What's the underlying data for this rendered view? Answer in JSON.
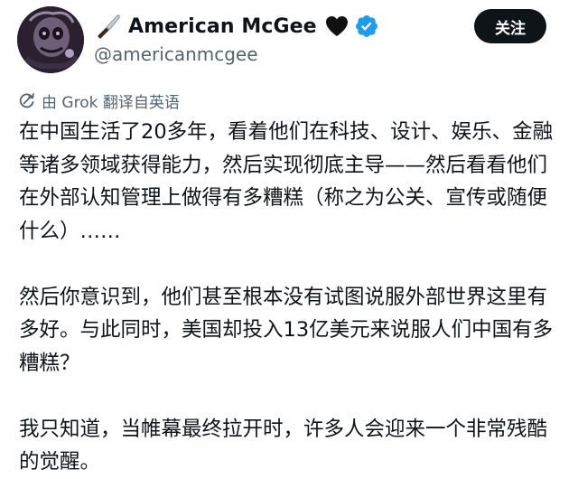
{
  "author": {
    "display_name": "American McGee",
    "handle": "@americanmcgee",
    "knife_emoji_icon": "kitchen-knife-icon",
    "heart_emoji_icon": "black-heart-icon",
    "verified_icon": "verified-badge-icon",
    "verified_color": "#1d9bf0"
  },
  "follow_button": {
    "label": "关注",
    "background": "#0f1419",
    "text_color": "#ffffff"
  },
  "translation": {
    "label": "由 Grok 翻译自英语",
    "icon": "translate-icon"
  },
  "tweet": {
    "paragraphs": [
      "在中国生活了20多年，看着他们在科技、设计、娱乐、金融等诸多领域获得能力，然后实现彻底主导——然后看看他们在外部认知管理上做得有多糟糕（称之为公关、宣传或随便什么）……",
      "然后你意识到，他们甚至根本没有试图说服外部世界这里有多好。与此同时，美国却投入13亿美元来说服人们中国有多糟糕？",
      "我只知道，当帷幕最终拉开时，许多人会迎来一个非常残酷的觉醒。"
    ]
  },
  "colors": {
    "text_primary": "#0f1419",
    "text_secondary": "#536471",
    "background": "#ffffff"
  }
}
